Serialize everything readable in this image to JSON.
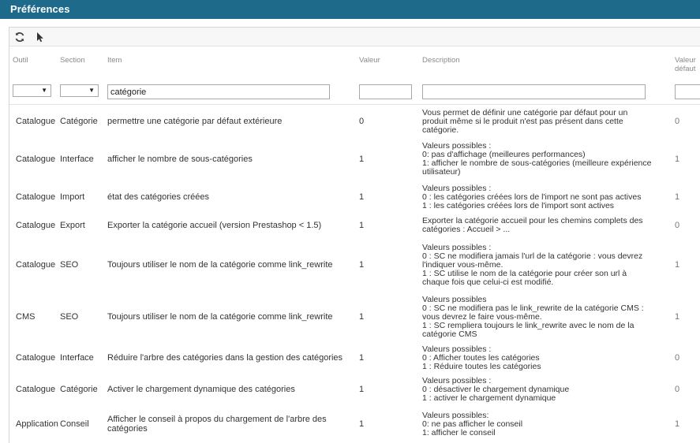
{
  "window": {
    "title": "Préférences"
  },
  "toolbar": {
    "refresh_icon": "refresh-icon",
    "select_icon": "cursor-icon"
  },
  "columns": {
    "outil": "Outil",
    "section": "Section",
    "item": "Item",
    "valeur": "Valeur",
    "description": "Description",
    "defaut_line1": "Valeur",
    "defaut_line2": "défaut"
  },
  "filters": {
    "item_value": "catégorie",
    "valeur_value": "",
    "description_value": "",
    "defaut_value": ""
  },
  "rows": [
    {
      "outil": "Catalogue",
      "section": "Catégorie",
      "item": "permettre une catégorie par défaut extérieure",
      "valeur": "0",
      "desc": [
        "Vous permet de définir une catégorie par défaut pour un",
        "produit même si le produit n'est pas présent dans cette",
        "catégorie."
      ],
      "defaut": "0"
    },
    {
      "outil": "Catalogue",
      "section": "Interface",
      "item": "afficher le nombre de sous-catégories",
      "valeur": "1",
      "desc": [
        "Valeurs possibles :",
        "0: pas d'affichage (meilleures performances)",
        "1: afficher le nombre de sous-catégories (meilleure expérience",
        "utilisateur)"
      ],
      "defaut": "1"
    },
    {
      "outil": "Catalogue",
      "section": "Import",
      "item": "état des catégories créées",
      "valeur": "1",
      "desc": [
        "Valeurs possibles :",
        "0 : les catégories créées lors de l'import ne sont pas actives",
        "1 : les catégories créées lors de l'import sont actives"
      ],
      "defaut": "1"
    },
    {
      "outil": "Catalogue",
      "section": "Export",
      "item": "Exporter la catégorie accueil (version Prestashop < 1.5)",
      "valeur": "1",
      "desc": [
        "Exporter la catégorie accueil pour les chemins complets des",
        "catégories : Accueil > ..."
      ],
      "defaut": "0"
    },
    {
      "outil": "Catalogue",
      "section": "SEO",
      "item": "Toujours utiliser le nom de la catégorie comme link_rewrite",
      "valeur": "1",
      "desc": [
        "Valeurs possibles :",
        "0 : SC ne modifiera jamais l'url de la catégorie : vous devrez",
        "l'indiquer vous-même.",
        "1 : SC utilise le nom de la catégorie pour créer son url à",
        "chaque fois que celui-ci est modifié."
      ],
      "defaut": "1"
    },
    {
      "outil": "CMS",
      "section": "SEO",
      "item": "Toujours utiliser le nom de la catégorie comme link_rewrite",
      "valeur": "1",
      "desc": [
        "Valeurs possibles",
        "0 : SC ne modifiera pas le link_rewrite de la catégorie CMS :",
        "vous devrez le faire vous-même.",
        "1 : SC rempliera toujours le link_rewrite avec le nom de la",
        "catégorie CMS"
      ],
      "defaut": "1"
    },
    {
      "outil": "Catalogue",
      "section": "Interface",
      "item": "Réduire l'arbre des catégories dans la gestion des catégories",
      "valeur": "1",
      "desc": [
        "Valeurs possibles :",
        "0 : Afficher toutes les catégories",
        "1 : Réduire toutes les catégories"
      ],
      "defaut": "0"
    },
    {
      "outil": "Catalogue",
      "section": "Catégorie",
      "item": "Activer le chargement dynamique des catégories",
      "valeur": "1",
      "desc": [
        "Valeurs possibles :",
        "0 : désactiver le chargement dynamique",
        "1 : activer le chargement dynamique"
      ],
      "defaut": "0"
    },
    {
      "outil": "Application",
      "section": "Conseil",
      "item": "Afficher le conseil à propos du chargement de l'arbre des catégories",
      "valeur": "1",
      "desc": [
        "Valeurs possibles:",
        "0: ne pas afficher le conseil",
        "1: afficher le conseil"
      ],
      "defaut": "1"
    }
  ]
}
